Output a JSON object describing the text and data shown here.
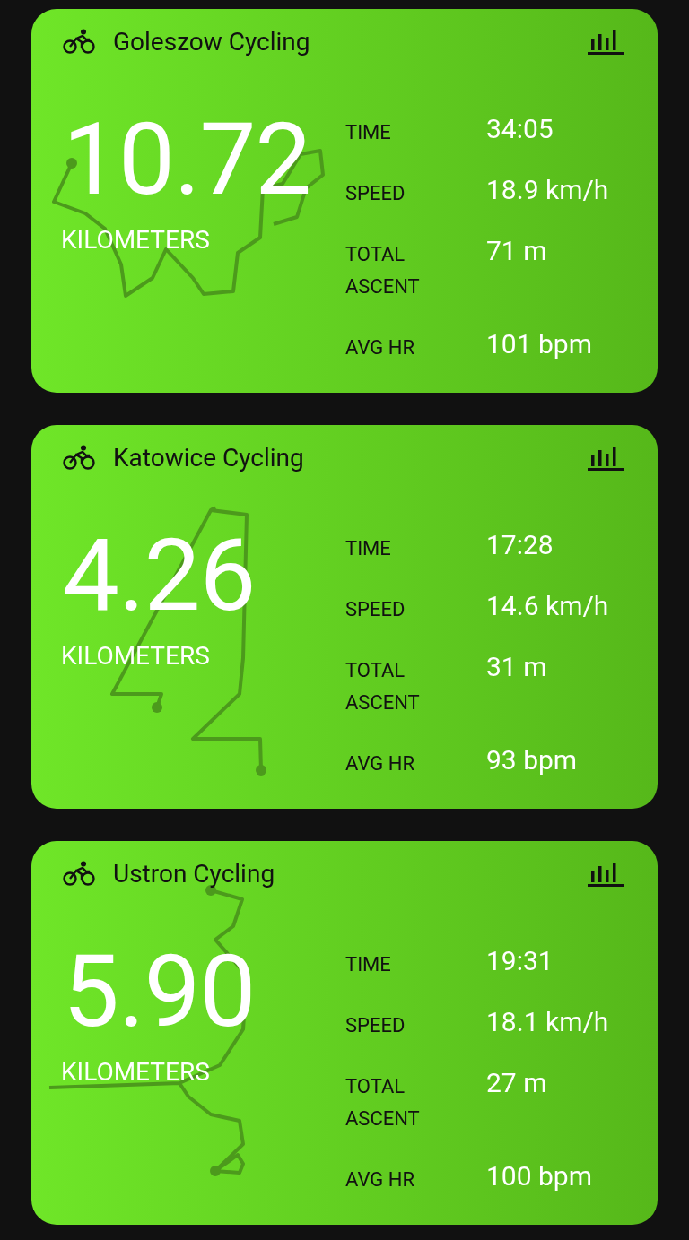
{
  "activities": [
    {
      "title": "Goleszow Cycling",
      "distance": "10.72",
      "distance_unit": "KILOMETERS",
      "stats": [
        {
          "label": "TIME",
          "value": "34:05"
        },
        {
          "label": "SPEED",
          "value": "18.9 km/h"
        },
        {
          "label": "TOTAL ASCENT",
          "value": "71 m"
        },
        {
          "label": "AVG HR",
          "value": "101 bpm"
        }
      ]
    },
    {
      "title": "Katowice Cycling",
      "distance": "4.26",
      "distance_unit": "KILOMETERS",
      "stats": [
        {
          "label": "TIME",
          "value": "17:28"
        },
        {
          "label": "SPEED",
          "value": "14.6 km/h"
        },
        {
          "label": "TOTAL ASCENT",
          "value": "31 m"
        },
        {
          "label": "AVG HR",
          "value": "93 bpm"
        }
      ]
    },
    {
      "title": "Ustron Cycling",
      "distance": "5.90",
      "distance_unit": "KILOMETERS",
      "stats": [
        {
          "label": "TIME",
          "value": "19:31"
        },
        {
          "label": "SPEED",
          "value": "18.1 km/h"
        },
        {
          "label": "TOTAL ASCENT",
          "value": "27 m"
        },
        {
          "label": "AVG HR",
          "value": "100 bpm"
        }
      ]
    }
  ]
}
